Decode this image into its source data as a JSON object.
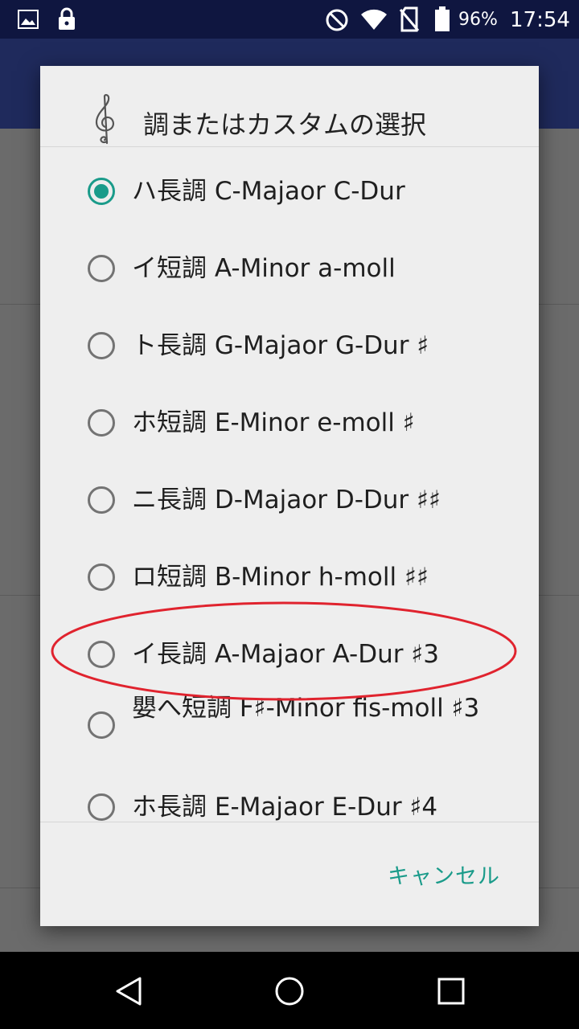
{
  "status_bar": {
    "icons": [
      "image-icon",
      "lock-icon",
      "dnd-icon",
      "wifi-icon",
      "no-sim-icon",
      "battery-icon"
    ],
    "battery": "96%",
    "time": "17:54"
  },
  "dialog": {
    "title_icon": "treble-clef-icon",
    "title": "調またはカスタムの選択",
    "options": [
      {
        "label": "ハ長調 C-Majaor C-Dur",
        "checked": true
      },
      {
        "label": "イ短調 A-Minor a-moll",
        "checked": false
      },
      {
        "label": "ト長調 G-Majaor G-Dur ♯",
        "checked": false
      },
      {
        "label": "ホ短調 E-Minor e-moll ♯",
        "checked": false
      },
      {
        "label": "ニ長調 D-Majaor D-Dur ♯♯",
        "checked": false
      },
      {
        "label": "ロ短調 B-Minor h-moll ♯♯",
        "checked": false
      },
      {
        "label": "イ長調 A-Majaor A-Dur ♯3",
        "checked": false
      },
      {
        "label": "嬰へ短調 F♯-Minor fis-moll ♯3",
        "checked": false
      },
      {
        "label": "ホ長調 E-Majaor E-Dur ♯4",
        "checked": false
      }
    ],
    "cancel_label": "キャンセル",
    "accent_color": "#1a9b8a",
    "annotation_color": "#e0232e"
  },
  "nav_bar": {
    "icons": [
      "back-icon",
      "home-icon",
      "recents-icon"
    ]
  }
}
